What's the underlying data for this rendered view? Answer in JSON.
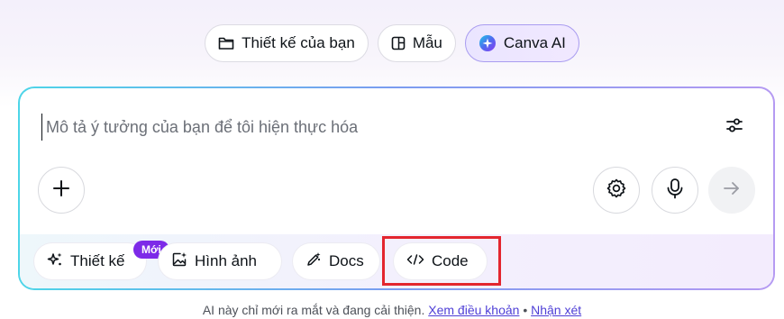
{
  "tabs": [
    {
      "label": "Thiết kế của bạn",
      "icon": "folder-icon"
    },
    {
      "label": "Mẫu",
      "icon": "template-icon"
    },
    {
      "label": "Canva AI",
      "icon": "canva-ai-icon",
      "active": true
    }
  ],
  "prompt": {
    "placeholder": "Mô tả ý tưởng của bạn để tôi hiện thực hóa",
    "value": ""
  },
  "actions": {
    "filter_icon": "sliders-icon",
    "add_icon": "plus-icon",
    "settings_icon": "gear-icon",
    "mic_icon": "microphone-icon",
    "send_icon": "arrow-right-icon"
  },
  "tools": [
    {
      "label": "Thiết kế",
      "icon": "sparkle-icon",
      "badge": "Mới"
    },
    {
      "label": "Hình ảnh",
      "icon": "image-sparkle-icon"
    },
    {
      "label": "Docs",
      "icon": "pen-sparkle-icon"
    },
    {
      "label": "Code",
      "icon": "code-icon"
    }
  ],
  "footer": {
    "text": "AI này chỉ mới ra mắt và đang cải thiện.",
    "terms_link": "Xem điều khoản",
    "separator": "•",
    "feedback_link": "Nhận xét"
  },
  "colors": {
    "accent": "#7d2ae8",
    "link": "#4e3fd6",
    "highlight": "#e3262f"
  }
}
